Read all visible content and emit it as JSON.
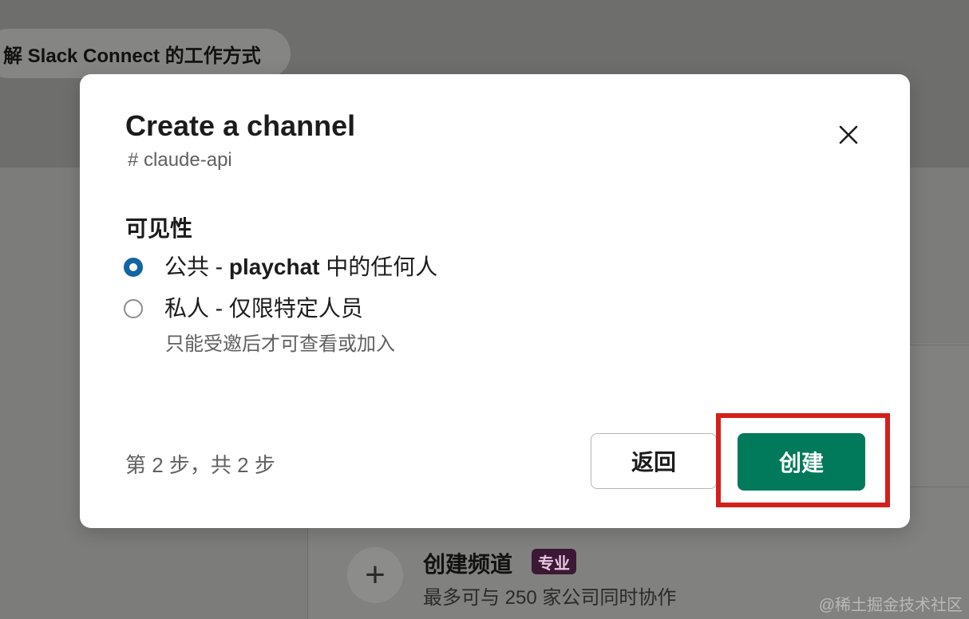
{
  "background": {
    "pill_text": "解 Slack Connect 的工作方式",
    "create_channel": {
      "plus": "+",
      "title": "创建频道",
      "badge": "专业",
      "subtitle": "最多可与 250 家公司同时协作"
    },
    "watermark": "@稀土掘金技术社区"
  },
  "modal": {
    "title": "Create a channel",
    "channel_name": "# claude-api",
    "close_icon": "close-icon",
    "visibility_label": "可见性",
    "options": [
      {
        "prefix": "公共 - ",
        "bold": "playchat",
        "suffix": " 中的任何人",
        "selected": true
      },
      {
        "prefix": "私人 - 仅限特定人员",
        "bold": "",
        "suffix": "",
        "selected": false,
        "hint": "只能受邀后才可查看或加入"
      }
    ],
    "step_text": "第 2 步，共 2 步",
    "back_label": "返回",
    "create_label": "创建"
  },
  "annotation": {
    "highlight_color": "#d51f1a"
  },
  "colors": {
    "primary": "#007a5a",
    "radio_selected": "#1264a3",
    "badge": "#3b1833"
  }
}
